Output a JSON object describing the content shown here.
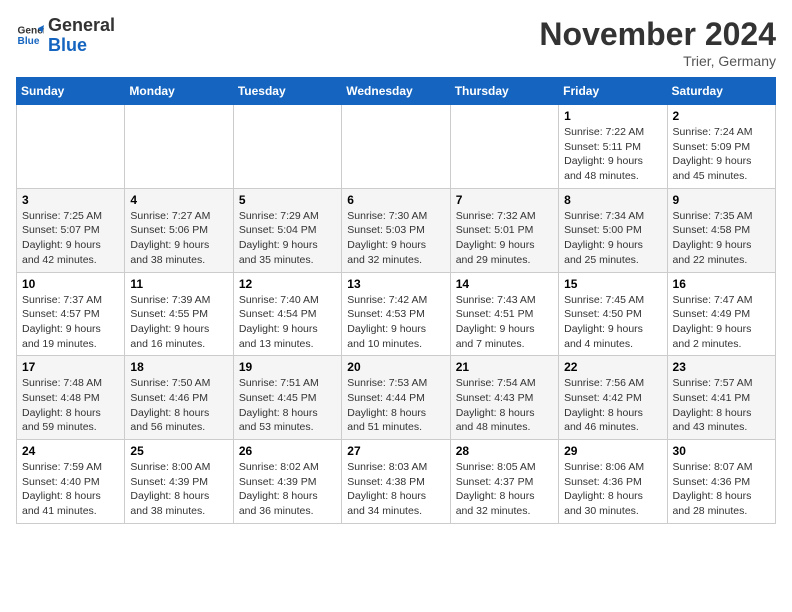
{
  "logo": {
    "line1": "General",
    "line2": "Blue"
  },
  "title": "November 2024",
  "location": "Trier, Germany",
  "weekdays": [
    "Sunday",
    "Monday",
    "Tuesday",
    "Wednesday",
    "Thursday",
    "Friday",
    "Saturday"
  ],
  "weeks": [
    [
      {
        "day": "",
        "info": ""
      },
      {
        "day": "",
        "info": ""
      },
      {
        "day": "",
        "info": ""
      },
      {
        "day": "",
        "info": ""
      },
      {
        "day": "",
        "info": ""
      },
      {
        "day": "1",
        "info": "Sunrise: 7:22 AM\nSunset: 5:11 PM\nDaylight: 9 hours and 48 minutes."
      },
      {
        "day": "2",
        "info": "Sunrise: 7:24 AM\nSunset: 5:09 PM\nDaylight: 9 hours and 45 minutes."
      }
    ],
    [
      {
        "day": "3",
        "info": "Sunrise: 7:25 AM\nSunset: 5:07 PM\nDaylight: 9 hours and 42 minutes."
      },
      {
        "day": "4",
        "info": "Sunrise: 7:27 AM\nSunset: 5:06 PM\nDaylight: 9 hours and 38 minutes."
      },
      {
        "day": "5",
        "info": "Sunrise: 7:29 AM\nSunset: 5:04 PM\nDaylight: 9 hours and 35 minutes."
      },
      {
        "day": "6",
        "info": "Sunrise: 7:30 AM\nSunset: 5:03 PM\nDaylight: 9 hours and 32 minutes."
      },
      {
        "day": "7",
        "info": "Sunrise: 7:32 AM\nSunset: 5:01 PM\nDaylight: 9 hours and 29 minutes."
      },
      {
        "day": "8",
        "info": "Sunrise: 7:34 AM\nSunset: 5:00 PM\nDaylight: 9 hours and 25 minutes."
      },
      {
        "day": "9",
        "info": "Sunrise: 7:35 AM\nSunset: 4:58 PM\nDaylight: 9 hours and 22 minutes."
      }
    ],
    [
      {
        "day": "10",
        "info": "Sunrise: 7:37 AM\nSunset: 4:57 PM\nDaylight: 9 hours and 19 minutes."
      },
      {
        "day": "11",
        "info": "Sunrise: 7:39 AM\nSunset: 4:55 PM\nDaylight: 9 hours and 16 minutes."
      },
      {
        "day": "12",
        "info": "Sunrise: 7:40 AM\nSunset: 4:54 PM\nDaylight: 9 hours and 13 minutes."
      },
      {
        "day": "13",
        "info": "Sunrise: 7:42 AM\nSunset: 4:53 PM\nDaylight: 9 hours and 10 minutes."
      },
      {
        "day": "14",
        "info": "Sunrise: 7:43 AM\nSunset: 4:51 PM\nDaylight: 9 hours and 7 minutes."
      },
      {
        "day": "15",
        "info": "Sunrise: 7:45 AM\nSunset: 4:50 PM\nDaylight: 9 hours and 4 minutes."
      },
      {
        "day": "16",
        "info": "Sunrise: 7:47 AM\nSunset: 4:49 PM\nDaylight: 9 hours and 2 minutes."
      }
    ],
    [
      {
        "day": "17",
        "info": "Sunrise: 7:48 AM\nSunset: 4:48 PM\nDaylight: 8 hours and 59 minutes."
      },
      {
        "day": "18",
        "info": "Sunrise: 7:50 AM\nSunset: 4:46 PM\nDaylight: 8 hours and 56 minutes."
      },
      {
        "day": "19",
        "info": "Sunrise: 7:51 AM\nSunset: 4:45 PM\nDaylight: 8 hours and 53 minutes."
      },
      {
        "day": "20",
        "info": "Sunrise: 7:53 AM\nSunset: 4:44 PM\nDaylight: 8 hours and 51 minutes."
      },
      {
        "day": "21",
        "info": "Sunrise: 7:54 AM\nSunset: 4:43 PM\nDaylight: 8 hours and 48 minutes."
      },
      {
        "day": "22",
        "info": "Sunrise: 7:56 AM\nSunset: 4:42 PM\nDaylight: 8 hours and 46 minutes."
      },
      {
        "day": "23",
        "info": "Sunrise: 7:57 AM\nSunset: 4:41 PM\nDaylight: 8 hours and 43 minutes."
      }
    ],
    [
      {
        "day": "24",
        "info": "Sunrise: 7:59 AM\nSunset: 4:40 PM\nDaylight: 8 hours and 41 minutes."
      },
      {
        "day": "25",
        "info": "Sunrise: 8:00 AM\nSunset: 4:39 PM\nDaylight: 8 hours and 38 minutes."
      },
      {
        "day": "26",
        "info": "Sunrise: 8:02 AM\nSunset: 4:39 PM\nDaylight: 8 hours and 36 minutes."
      },
      {
        "day": "27",
        "info": "Sunrise: 8:03 AM\nSunset: 4:38 PM\nDaylight: 8 hours and 34 minutes."
      },
      {
        "day": "28",
        "info": "Sunrise: 8:05 AM\nSunset: 4:37 PM\nDaylight: 8 hours and 32 minutes."
      },
      {
        "day": "29",
        "info": "Sunrise: 8:06 AM\nSunset: 4:36 PM\nDaylight: 8 hours and 30 minutes."
      },
      {
        "day": "30",
        "info": "Sunrise: 8:07 AM\nSunset: 4:36 PM\nDaylight: 8 hours and 28 minutes."
      }
    ]
  ]
}
